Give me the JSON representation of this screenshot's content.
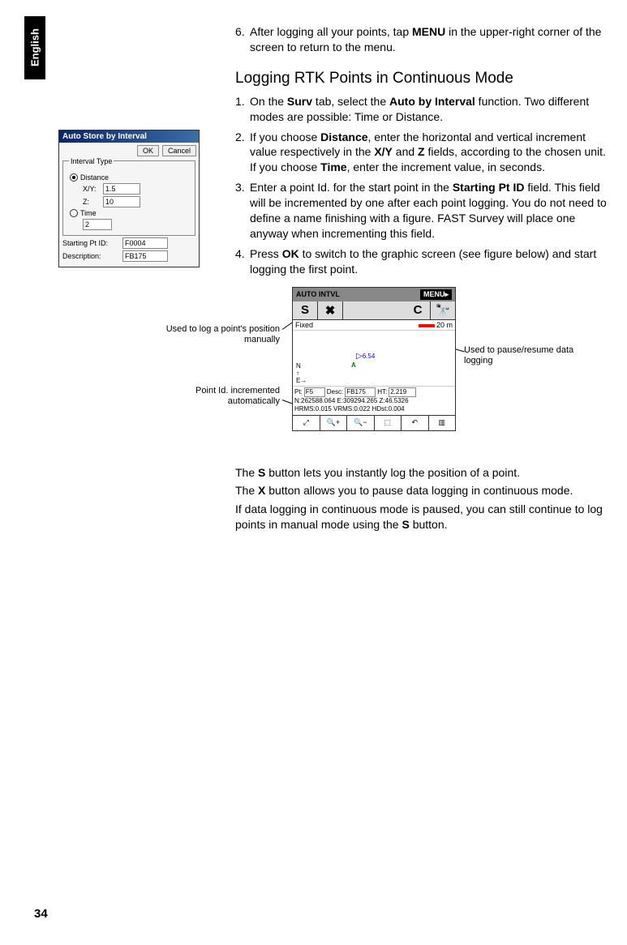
{
  "lang_tab": "English",
  "step6": {
    "num": "6.",
    "text_a": "After logging all your points, tap ",
    "text_b": "MENU",
    "text_c": " in the upper-right corner of the screen to return to the menu."
  },
  "heading2": "Logging RTK Points in Continuous Mode",
  "step1": {
    "num": "1.",
    "a": "On the ",
    "b": "Surv",
    "c": " tab, select the ",
    "d": "Auto by Interval",
    "e": " function. Two different modes are possible: Time or Distance."
  },
  "step2": {
    "num": "2.",
    "a": "If you choose ",
    "b": "Distance",
    "c": ", enter the horizontal and vertical increment value respectively in the ",
    "d": "X/Y",
    "e": " and ",
    "f": "Z",
    "g": " fields, according to the chosen unit. If you choose ",
    "h": "Time",
    "i": ", enter the increment value, in seconds."
  },
  "step3": {
    "num": "3.",
    "a": "Enter a point Id. for the start point in the ",
    "b": "Starting Pt ID",
    "c": " field. This field will be incremented by one after each point logging. You do not need to define a name finishing with a figure. FAST Survey will place one anyway when incrementing this field."
  },
  "step4": {
    "num": "4.",
    "a": "Press ",
    "b": "OK",
    "c": " to switch to the graphic screen (see figure below) and start logging the first point."
  },
  "dialog1": {
    "title": "Auto Store by Interval",
    "ok": "OK",
    "cancel": "Cancel",
    "group": "Interval Type",
    "distance": "Distance",
    "xy_label": "X/Y:",
    "xy_val": "1.5",
    "z_label": "Z:",
    "z_val": "10",
    "time": "Time",
    "time_val": "2",
    "start_label": "Starting Pt ID:",
    "start_val": "F0004",
    "desc_label": "Description:",
    "desc_val": "FB175"
  },
  "dialog2": {
    "title": "AUTO INTVL",
    "menu": "MENU▸",
    "s": "S",
    "x": "✖",
    "c": "C",
    "status_fixed": "Fixed",
    "scale": "20 m",
    "point_label": "6.54",
    "a_marker": "A",
    "compass": "N\n↑\nE→",
    "pt_lab": "Pt:",
    "pt_val": "F5",
    "desc_lab": "Desc:",
    "desc_val": "FB175",
    "ht_lab": "HT:",
    "ht_val": "2.219",
    "ne": "N:262588.064 E:309294.265 Z:46.5326",
    "hrms": "HRMS:0.015 VRMS:0.022 HDst:0.004"
  },
  "callouts": {
    "left1": "Used to log a point's position manually",
    "right1": "Used to pause/resume data logging",
    "left2": "Point Id. incremented automatically"
  },
  "para1": {
    "a": "The ",
    "b": "S",
    "c": " button lets you instantly log the position of a point."
  },
  "para2": {
    "a": "The ",
    "b": "X",
    "c": " button allows you to pause data logging in continuous mode."
  },
  "para3": {
    "a": "If data logging in continuous mode is paused, you can still continue to log points in manual mode using the ",
    "b": "S",
    "c": " button."
  },
  "pagenum": "34"
}
